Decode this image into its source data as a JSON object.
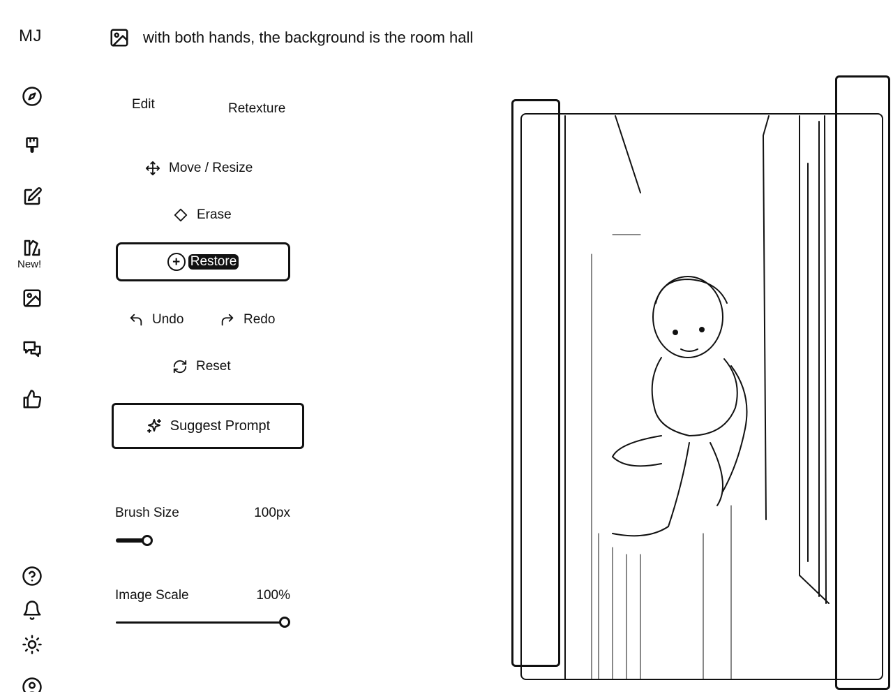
{
  "app": {
    "logo": "MJ"
  },
  "sidebar": {
    "new_badge": "New!"
  },
  "prompt": {
    "text": "with both hands, the background is the room hall"
  },
  "tabs": [
    {
      "label": "Edit"
    },
    {
      "label": "Retexture"
    }
  ],
  "tools": {
    "move_resize": "Move / Resize",
    "erase": "Erase",
    "restore": "Restore",
    "undo": "Undo",
    "redo": "Redo",
    "reset": "Reset",
    "suggest_prompt": "Suggest Prompt"
  },
  "brush": {
    "label": "Brush Size",
    "value": "100px",
    "level": 0.2
  },
  "scale": {
    "label": "Image Scale",
    "value": "100%",
    "level": 1.0
  },
  "icons": {
    "nav": [
      "compass-icon",
      "brush-icon",
      "edit-icon",
      "new-feature-icon",
      "image-icon",
      "chat-icon",
      "thumbs-up-icon",
      "help-icon",
      "bell-icon",
      "sun-icon",
      "user-icon"
    ]
  }
}
